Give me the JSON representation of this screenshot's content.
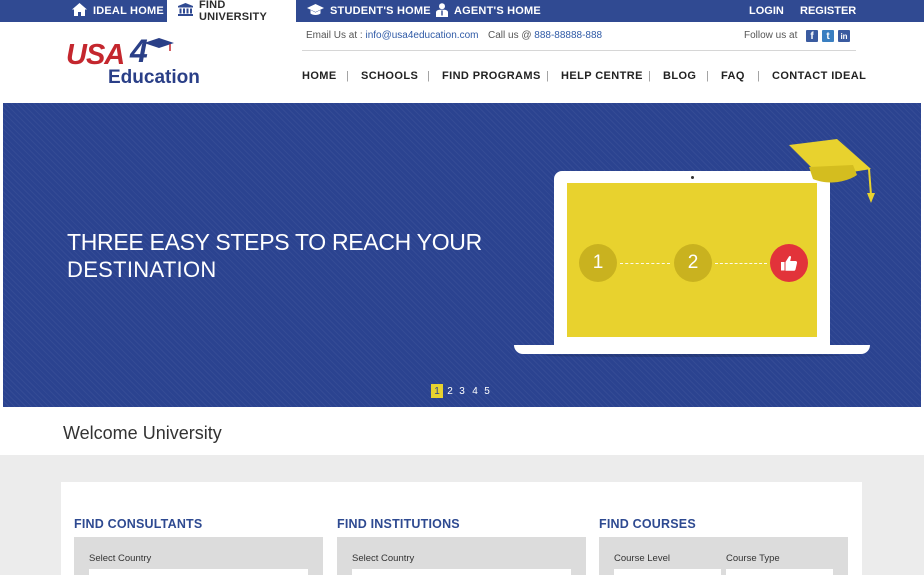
{
  "top_nav": {
    "tabs": [
      {
        "label": "IDEAL HOME",
        "icon": "home-icon"
      },
      {
        "label": "FIND UNIVERSITY",
        "icon": "university-icon",
        "active": true
      },
      {
        "label": "STUDENT'S HOME",
        "icon": "graduation-cap-icon"
      },
      {
        "label": "AGENT'S HOME",
        "icon": "agent-icon"
      }
    ],
    "login": "LOGIN",
    "register": "REGISTER"
  },
  "header": {
    "logo": {
      "usa": "USA",
      "four": "4",
      "education": "Education"
    },
    "email_label": "Email Us at : ",
    "email": "info@usa4education.com",
    "phone_label": "Call us @ ",
    "phone": "888-88888-888",
    "follow_label": "Follow us at",
    "social": [
      {
        "name": "facebook-icon",
        "glyph": "f"
      },
      {
        "name": "twitter-icon",
        "glyph": "t"
      },
      {
        "name": "linkedin-icon",
        "glyph": "in"
      }
    ]
  },
  "main_nav": [
    "HOME",
    "SCHOOLS",
    "FIND PROGRAMS",
    "HELP CENTRE",
    "BLOG",
    "FAQ",
    "CONTACT IDEAL"
  ],
  "hero": {
    "line1": "THREE EASY STEPS TO REACH YOUR",
    "line2": "DESTINATION",
    "steps": [
      "1",
      "2"
    ],
    "pages": [
      "1",
      "2",
      "3",
      "4",
      "5"
    ],
    "active_page": "1",
    "colors": {
      "background": "#2b4390",
      "accent": "#e8d22e",
      "like": "#e2333a"
    }
  },
  "welcome": "Welcome University",
  "sections": [
    {
      "title": "FIND CONSULTANTS",
      "fields": [
        "Select Country"
      ]
    },
    {
      "title": "FIND INSTITUTIONS",
      "fields": [
        "Select Country"
      ]
    },
    {
      "title": "FIND COURSES",
      "fields": [
        "Course Level",
        "Course Type"
      ]
    }
  ]
}
